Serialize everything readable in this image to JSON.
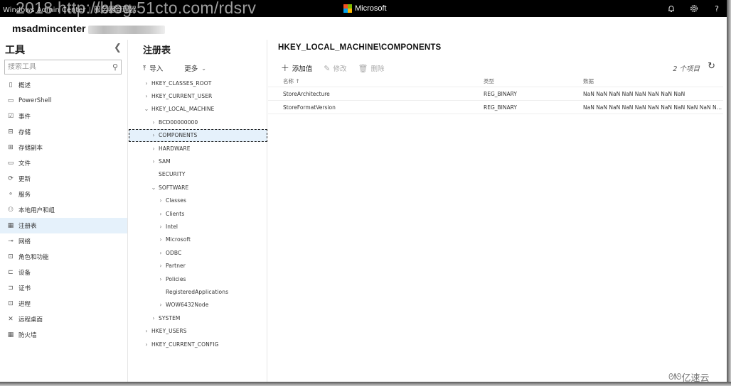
{
  "topbar": {
    "app_title": "Windows Admin Center",
    "app_subtitle": "服务器管理器",
    "watermark": "2018 http://blog.51cto.com/rdsrv",
    "brand": "Microsoft",
    "icons": [
      "bell-icon",
      "gear-icon",
      "help-icon"
    ],
    "brand_colors": [
      "#f25022",
      "#7fba00",
      "#00a4ef",
      "#ffb900"
    ]
  },
  "server": {
    "name": "msadmincenter"
  },
  "tools": {
    "title": "工具",
    "search_placeholder": "搜索工具",
    "items": [
      {
        "label": "概述",
        "icon": "device-icon"
      },
      {
        "label": "PowerShell",
        "icon": "powershell-icon"
      },
      {
        "label": "事件",
        "icon": "events-icon"
      },
      {
        "label": "存储",
        "icon": "storage-icon"
      },
      {
        "label": "存储副本",
        "icon": "storage-replica-icon"
      },
      {
        "label": "文件",
        "icon": "files-icon"
      },
      {
        "label": "更新",
        "icon": "updates-icon"
      },
      {
        "label": "服务",
        "icon": "services-icon"
      },
      {
        "label": "本地用户和组",
        "icon": "users-icon"
      },
      {
        "label": "注册表",
        "icon": "registry-icon",
        "active": true
      },
      {
        "label": "网络",
        "icon": "network-icon"
      },
      {
        "label": "角色和功能",
        "icon": "roles-icon"
      },
      {
        "label": "设备",
        "icon": "devices-icon"
      },
      {
        "label": "证书",
        "icon": "certificates-icon"
      },
      {
        "label": "进程",
        "icon": "processes-icon"
      },
      {
        "label": "远程桌面",
        "icon": "remote-desktop-icon"
      },
      {
        "label": "防火墙",
        "icon": "firewall-icon"
      }
    ]
  },
  "registry": {
    "title": "注册表",
    "import_label": "导入",
    "more_label": "更多",
    "tree": [
      {
        "label": "HKEY_CLASSES_ROOT",
        "level": 0,
        "chevron": "collapsed"
      },
      {
        "label": "HKEY_CURRENT_USER",
        "level": 0,
        "chevron": "collapsed"
      },
      {
        "label": "HKEY_LOCAL_MACHINE",
        "level": 0,
        "chevron": "expanded"
      },
      {
        "label": "BCD00000000",
        "level": 1,
        "chevron": "collapsed"
      },
      {
        "label": "COMPONENTS",
        "level": 1,
        "chevron": "collapsed",
        "selected": true
      },
      {
        "label": "HARDWARE",
        "level": 1,
        "chevron": "collapsed"
      },
      {
        "label": "SAM",
        "level": 1,
        "chevron": "collapsed"
      },
      {
        "label": "SECURITY",
        "level": 1,
        "chevron": "none"
      },
      {
        "label": "SOFTWARE",
        "level": 1,
        "chevron": "expanded"
      },
      {
        "label": "Classes",
        "level": 2,
        "chevron": "collapsed"
      },
      {
        "label": "Clients",
        "level": 2,
        "chevron": "collapsed"
      },
      {
        "label": "Intel",
        "level": 2,
        "chevron": "collapsed"
      },
      {
        "label": "Microsoft",
        "level": 2,
        "chevron": "collapsed"
      },
      {
        "label": "ODBC",
        "level": 2,
        "chevron": "collapsed"
      },
      {
        "label": "Partner",
        "level": 2,
        "chevron": "collapsed"
      },
      {
        "label": "Policies",
        "level": 2,
        "chevron": "collapsed"
      },
      {
        "label": "RegisteredApplications",
        "level": 2,
        "chevron": "none"
      },
      {
        "label": "WOW6432Node",
        "level": 2,
        "chevron": "collapsed"
      },
      {
        "label": "SYSTEM",
        "level": 1,
        "chevron": "collapsed"
      },
      {
        "label": "HKEY_USERS",
        "level": 0,
        "chevron": "collapsed"
      },
      {
        "label": "HKEY_CURRENT_CONFIG",
        "level": 0,
        "chevron": "collapsed"
      }
    ]
  },
  "main": {
    "title": "HKEY_LOCAL_MACHINE\\COMPONENTS",
    "add_label": "添加值",
    "edit_label": "修改",
    "delete_label": "删除",
    "item_count": "2 个项目",
    "columns": {
      "name": "名称 ↑",
      "type": "类型",
      "data": "数据"
    },
    "rows": [
      {
        "name": "StoreArchitecture",
        "type": "REG_BINARY",
        "data": "NaN NaN NaN NaN NaN NaN NaN NaN"
      },
      {
        "name": "StoreFormatVersion",
        "type": "REG_BINARY",
        "data": "NaN NaN NaN NaN NaN NaN NaN NaN NaN NaN NaN ..."
      }
    ]
  },
  "footer_brand": "亿速云"
}
